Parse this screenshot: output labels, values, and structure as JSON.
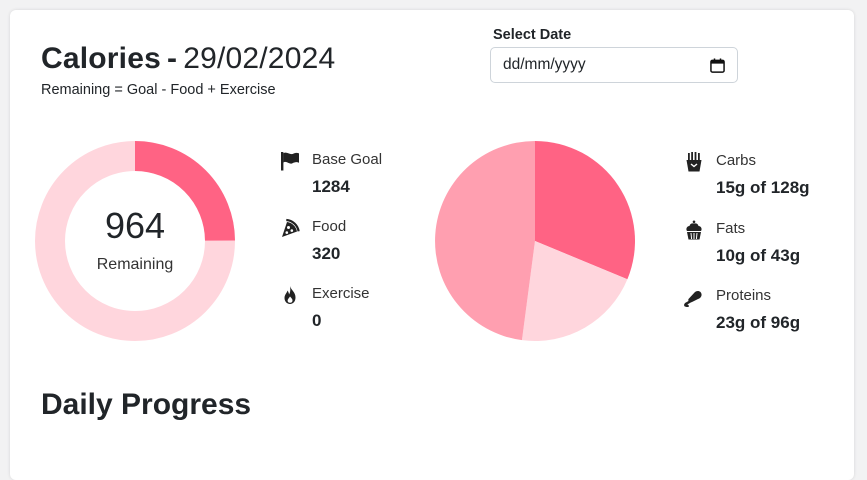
{
  "header": {
    "title": "Calories",
    "separator": "-",
    "date": "29/02/2024",
    "formula": "Remaining = Goal - Food + Exercise"
  },
  "date_picker": {
    "label": "Select Date",
    "placeholder": "dd/mm/yyyy",
    "icon": "calendar-icon"
  },
  "calories": {
    "remaining_value": "964",
    "remaining_label": "Remaining",
    "goal": 1284,
    "consumed": 320,
    "colors": {
      "consumed": "#ff6384",
      "remaining": "#ffd6dd"
    },
    "stats": [
      {
        "icon": "flag-icon",
        "label": "Base Goal",
        "value": "1284"
      },
      {
        "icon": "pizza-icon",
        "label": "Food",
        "value": "320"
      },
      {
        "icon": "fire-icon",
        "label": "Exercise",
        "value": "0"
      }
    ]
  },
  "macros": {
    "chart": {
      "slices": [
        {
          "name": "Carbs",
          "value": 15,
          "color": "#ff6384"
        },
        {
          "name": "Fats",
          "value": 10,
          "color": "#ffd6dd"
        },
        {
          "name": "Proteins",
          "value": 23,
          "color": "#ff9fb0"
        }
      ]
    },
    "stats": [
      {
        "icon": "fries-icon",
        "label": "Carbs",
        "value": "15g of 128g"
      },
      {
        "icon": "cupcake-icon",
        "label": "Fats",
        "value": "10g of 43g"
      },
      {
        "icon": "meat-icon",
        "label": "Proteins",
        "value": "23g of 96g"
      }
    ]
  },
  "progress": {
    "title": "Daily Progress"
  }
}
